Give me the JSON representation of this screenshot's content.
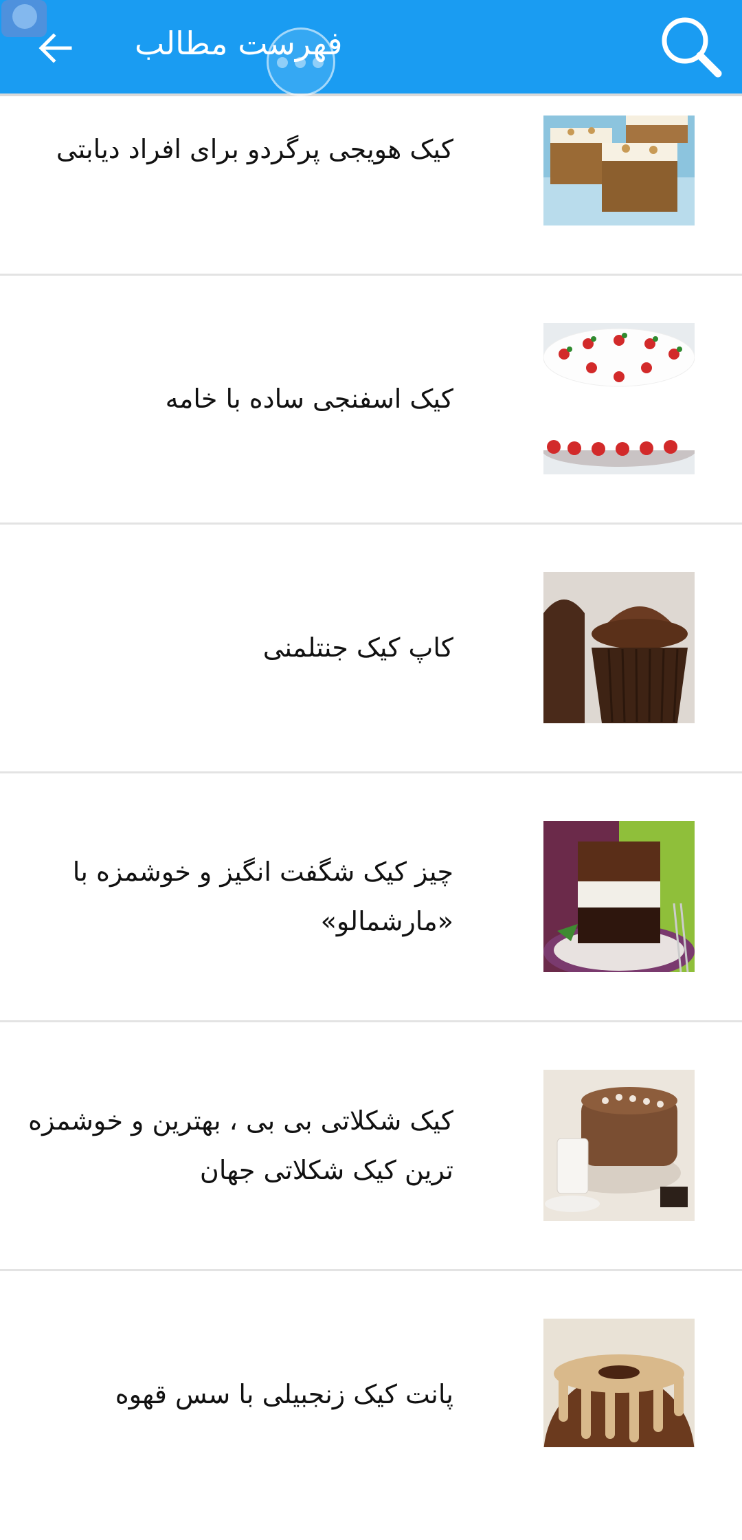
{
  "appbar": {
    "title": "فهرست مطالب",
    "back_icon": "arrow-left-icon",
    "search_icon": "search-icon",
    "color": "#1a9cf2"
  },
  "items": [
    {
      "title": "کیک هویجی پرگردو برای افراد دیابتی"
    },
    {
      "title": "کیک اسفنجی ساده با خامه"
    },
    {
      "title": "کاپ کیک جنتلمنی"
    },
    {
      "title": "چیز کیک شگفت انگیز و خوشمزه با «مارشمالو»"
    },
    {
      "title": "کیک شکلاتی بی بی ، بهترین و خوشمزه ترین کیک شکلاتی جهان"
    },
    {
      "title": "پانت کیک زنجبیلی با سس قهوه"
    }
  ]
}
